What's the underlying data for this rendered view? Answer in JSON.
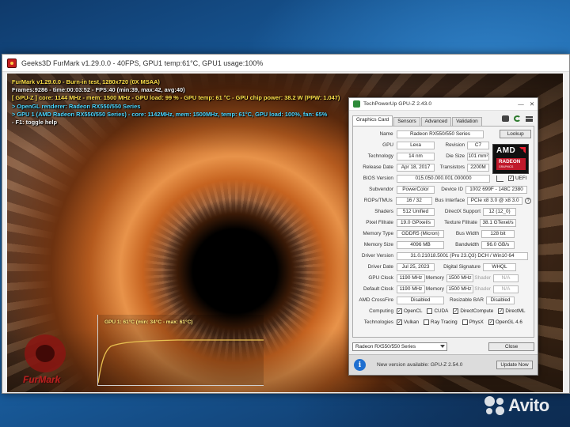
{
  "furmark": {
    "title": "Geeks3D FurMark v1.29.0.0 - 40FPS, GPU1 temp:61°C, GPU1 usage:100%",
    "osd": [
      {
        "text": "FurMark v1.29.0.0 - Burn-in test, 1280x720 (0X MSAA)",
        "color": "yellow"
      },
      {
        "text": "Frames:9286 - time:00:03:52 - FPS:40 (min:39, max:42, avg:40)",
        "color": "white"
      },
      {
        "text": "[ GPU-Z ] core: 1144 MHz - mem: 1500 MHz - GPU load: 99 % - GPU temp: 61 °C - GPU chip power: 38.2 W (PPW: 1.047)",
        "color": "yellow"
      },
      {
        "text": "> OpenGL renderer: Radeon RX550/550 Series",
        "color": "cyan"
      },
      {
        "text": "> GPU 1 (AMD Radeon RX550/550 Series) - core: 1142MHz, mem: 1500MHz, temp: 61°C, GPU load: 100%, fan: 65%",
        "color": "cyan"
      },
      {
        "text": "- F1: toggle help",
        "color": "white"
      }
    ],
    "temp_graph_label": "GPU 1: 61°C (min: 34°C - max: 61°C)",
    "logo_text": "FurMark"
  },
  "gpuz": {
    "title": "TechPowerUp GPU-Z 2.43.0",
    "tabs": [
      "Graphics Card",
      "Sensors",
      "Advanced",
      "Validation"
    ],
    "fields": {
      "name_label": "Name",
      "name": "Radeon RX550/550 Series",
      "lookup": "Lookup",
      "gpu_label": "GPU",
      "gpu": "Lexa",
      "revision_label": "Revision",
      "revision": "C7",
      "tech_label": "Technology",
      "tech": "14 nm",
      "die_label": "Die Size",
      "die": "101 mm²",
      "release_label": "Release Date",
      "release": "Apr 18, 2017",
      "transistors_label": "Transistors",
      "transistors": "2200M",
      "bios_label": "BIOS Version",
      "bios": "015.050.000.001.000000",
      "uefi_label": "UEFI",
      "subvendor_label": "Subvendor",
      "subvendor": "PowerColor",
      "device_label": "Device ID",
      "device": "1002 699F - 148C 2380",
      "rops_label": "ROPs/TMUs",
      "rops": "16 / 32",
      "bus_label": "Bus Interface",
      "bus": "PCIe x8 3.0 @ x8 3.0",
      "shaders_label": "Shaders",
      "shaders": "512 Unified",
      "dx_label": "DirectX Support",
      "dx": "12 (12_0)",
      "pixel_label": "Pixel Fillrate",
      "pixel": "19.0 GPixel/s",
      "texture_label": "Texture Fillrate",
      "texture": "38.1 GTexel/s",
      "memtype_label": "Memory Type",
      "memtype": "GDDR5 (Micron)",
      "buswidth_label": "Bus Width",
      "buswidth": "128 bit",
      "memsize_label": "Memory Size",
      "memsize": "4096 MB",
      "bandwidth_label": "Bandwidth",
      "bandwidth": "96.0 GB/s",
      "driver_label": "Driver Version",
      "driver": "31.0.21018.5001 (Pro 23.Q3) DCH / Win10 64",
      "driverdate_label": "Driver Date",
      "driverdate": "Jul 25, 2023",
      "sig_label": "Digital Signature",
      "sig": "WHQL",
      "gpuclock_label": "GPU Clock",
      "gpuclock": "1190 MHz",
      "mem_label": "Memory",
      "gpuclock_mem": "1500 MHz",
      "shader_label": "Shader",
      "na": "N/A",
      "defclock_label": "Default Clock",
      "defclock": "1190 MHz",
      "defclock_mem": "1500 MHz",
      "crossfire_label": "AMD CrossFire",
      "crossfire": "Disabled",
      "rebar_label": "Resizable BAR",
      "rebar": "Disabled",
      "computing_label": "Computing",
      "technologies_label": "Technologies"
    },
    "computing": [
      "OpenCL",
      "CUDA",
      "DirectCompute",
      "DirectML"
    ],
    "computing_checked": [
      "✓",
      "",
      "✓",
      "✓"
    ],
    "technologies": [
      "Vulkan",
      "Ray Tracing",
      "PhysX",
      "OpenGL 4.6"
    ],
    "technologies_checked": [
      "✓",
      "",
      "",
      "✓"
    ],
    "uefi_checked": "✓",
    "selected_gpu": "Radeon RX550/550 Series",
    "close": "Close",
    "update_text": "New version available: GPU-Z 2.54.0",
    "update_button": "Update Now",
    "amd_logo_text": "AMD",
    "radeon_logo_text": "RADEON",
    "radeon_logo_sub": "GRAPHICS"
  },
  "watermark": "Avito",
  "colors": {
    "osd_yellow": "#ffe14a",
    "osd_cyan": "#4ad6ff",
    "amd_red": "#c0192b",
    "info_blue": "#1f6fd0"
  }
}
